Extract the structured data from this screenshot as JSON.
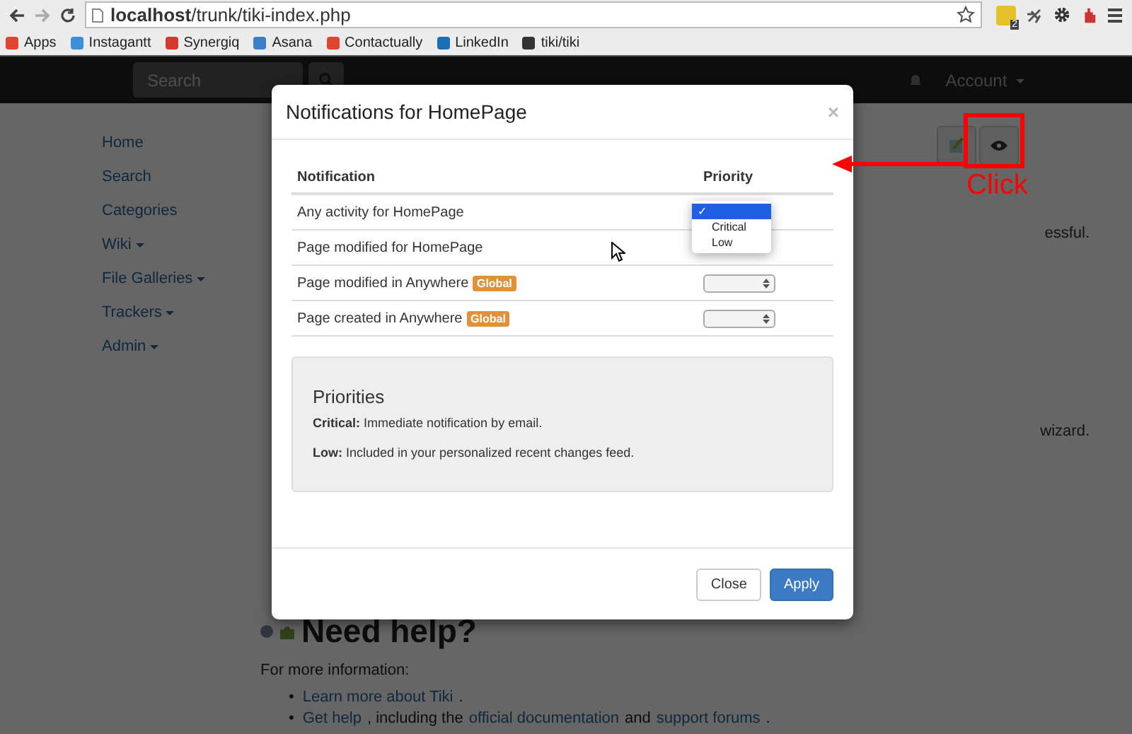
{
  "browser": {
    "url": "**localhost**/trunk/tiki-index.php",
    "extension_badge": "2",
    "bookmarks": [
      {
        "label": "Apps",
        "color": "#e0452f"
      },
      {
        "label": "Instagantt",
        "color": "#3b8ed8"
      },
      {
        "label": "Synergiq",
        "color": "#d23a2c"
      },
      {
        "label": "Asana",
        "color": "#3b7fc4"
      },
      {
        "label": "Contactually",
        "color": "#e0452f"
      },
      {
        "label": "LinkedIn",
        "color": "#1b6fb5"
      },
      {
        "label": "tiki/tiki",
        "color": "#333333"
      }
    ]
  },
  "navbar": {
    "search": {
      "placeholder": "Search"
    },
    "account": "Account"
  },
  "sidebar": {
    "items": [
      {
        "label": "Home",
        "has_menu": false
      },
      {
        "label": "Search",
        "has_menu": false
      },
      {
        "label": "Categories",
        "has_menu": false
      },
      {
        "label": "Wiki",
        "has_menu": true
      },
      {
        "label": "File Galleries",
        "has_menu": true
      },
      {
        "label": "Trackers",
        "has_menu": true
      },
      {
        "label": "Admin",
        "has_menu": true
      }
    ]
  },
  "page": {
    "cut_texts": [
      "essful.",
      "wizard."
    ],
    "heading": "Need help?",
    "intro": "For more information:",
    "links": [
      {
        "bullet": "•",
        "parts": [
          {
            "text": "Learn more about Tiki",
            "kind": "link"
          },
          {
            "text": ".",
            "kind": "text"
          }
        ]
      },
      {
        "bullet": "•",
        "parts": [
          {
            "text": "Get help",
            "kind": "link"
          },
          {
            "text": ", including the",
            "kind": "text"
          },
          {
            "text": "official documentation",
            "kind": "link"
          },
          {
            "text": "and",
            "kind": "text"
          },
          {
            "text": "support forums",
            "kind": "link"
          },
          {
            "text": ".",
            "kind": "text"
          }
        ]
      }
    ]
  },
  "modal": {
    "title": "Notifications for HomePage",
    "close": "×",
    "columns": [
      "Notification",
      "Priority"
    ],
    "rows": [
      {
        "label": "Any activity for HomePage",
        "dropdown": {
          "options": [
            {
              "label": "✓",
              "selected": true
            },
            {
              "label": "Critical",
              "selected": false
            },
            {
              "label": "Low",
              "selected": false
            }
          ]
        }
      },
      {
        "label": "Page modified for HomePage"
      },
      {
        "label": "Page modified in Anywhere",
        "badge": "Global"
      },
      {
        "label": "Page created in Anywhere",
        "badge": "Global"
      }
    ],
    "priorities": {
      "title": "Priorities",
      "lines": [
        "**Critical:** Immediate notification by email.",
        "**Low:** Included in your personalized recent changes feed."
      ]
    },
    "buttons": [
      {
        "label": "Close",
        "kind": "default"
      },
      {
        "label": "Apply",
        "kind": "primary"
      }
    ]
  },
  "annotation": {
    "label": "Click"
  }
}
